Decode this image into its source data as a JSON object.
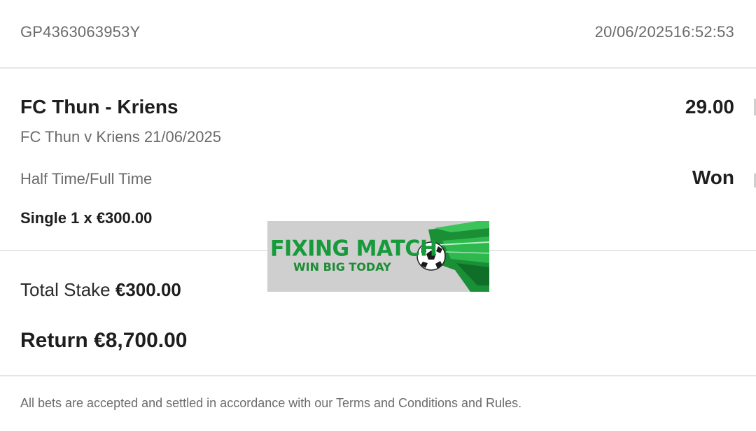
{
  "header": {
    "reference": "GP4363063953Y",
    "date": "20/06/2025",
    "time": "16:52:53"
  },
  "selection": {
    "match_name": "FC Thun - Kriens",
    "odds": "29.00",
    "event_line": "FC Thun v Kriens 21/06/2025",
    "market": "Half Time/Full Time",
    "result": "Won",
    "bet_line": "Single 1 x €300.00"
  },
  "summary": {
    "stake_label": "Total Stake",
    "stake_value": "€300.00",
    "return_label": "Return",
    "return_value": "€8,700.00"
  },
  "footer": {
    "terms_text": "All bets are accepted and settled in accordance with our Terms and Conditions and Rules."
  },
  "watermark": {
    "title": "FIXING MATCH",
    "subtitle": "WIN BIG TODAY",
    "icon": "soccer-ball-icon",
    "accent_color": "#169a3a"
  }
}
